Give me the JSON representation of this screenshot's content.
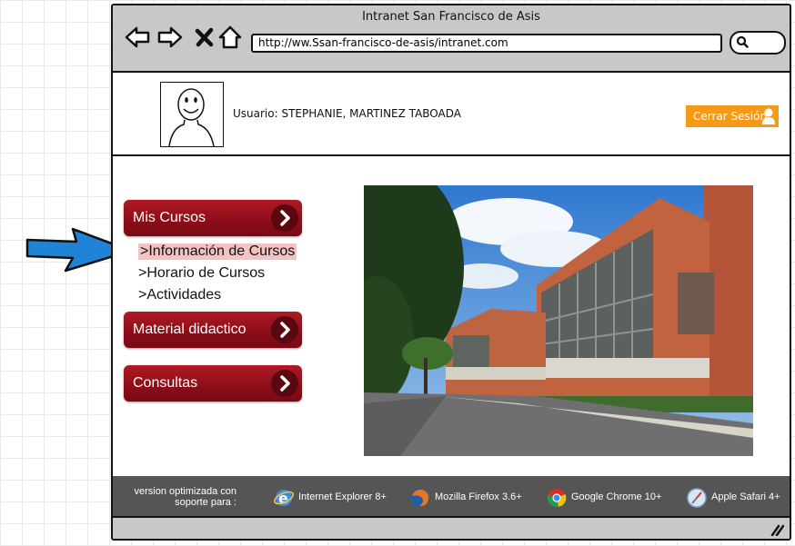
{
  "window": {
    "title": "Intranet San Francisco de Asis"
  },
  "browser_nav": {
    "back": "back-arrow-icon",
    "forward": "forward-arrow-icon",
    "stop": "close-icon",
    "home": "home-icon"
  },
  "address_bar": {
    "url": "http://ww.Ssan-francisco-de-asis/intranet.com"
  },
  "search": {
    "icon": "search-icon"
  },
  "user": {
    "label": "Usuario: STEPHANIE, MARTINEZ TABOADA"
  },
  "logout": {
    "label": "Cerrar Sesión",
    "color": "#f59a16"
  },
  "menu": {
    "accent": "#8a0d18",
    "mis_cursos": "Mis Cursos",
    "submenu": [
      ">Información de Cursos",
      ">Horario de Cursos",
      ">Actividades"
    ],
    "material": "Material didactico",
    "consultas": "Consultas"
  },
  "footer": {
    "support_text_1": "version optimizada con",
    "support_text_2": "soporte para :",
    "browsers": [
      "Internet Explorer 8+",
      "Mozilla Firefox 3.6+",
      "Google Chrome 10+",
      "Apple Safari 4+"
    ]
  }
}
